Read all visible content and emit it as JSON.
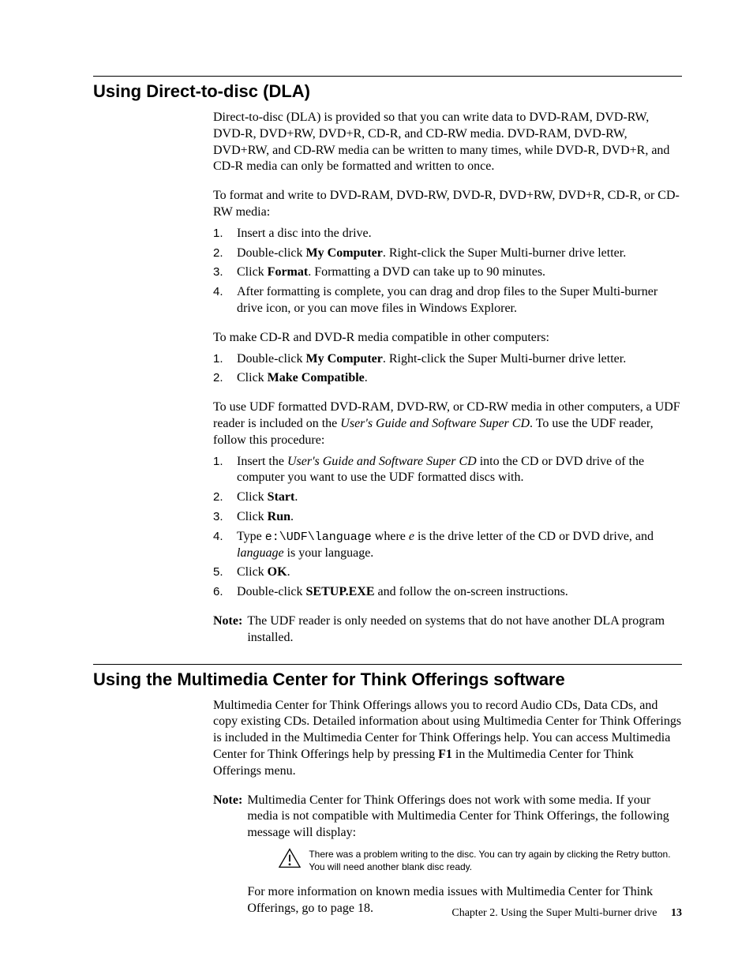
{
  "section1": {
    "heading": "Using Direct-to-disc (DLA)",
    "intro": "Direct-to-disc (DLA) is provided so that you can write data to DVD-RAM, DVD-RW, DVD-R, DVD+RW, DVD+R, CD-R, and CD-RW media. DVD-RAM, DVD-RW, DVD+RW, and CD-RW media can be written to many times, while DVD-R, DVD+R, and CD-R media can only be formatted and written to once.",
    "lead1": "To format and write to DVD-RAM, DVD-RW, DVD-R, DVD+RW, DVD+R, CD-R, or CD-RW media:",
    "steps1": {
      "s1": "Insert a disc into the drive.",
      "s2a": "Double-click ",
      "s2b": "My Computer",
      "s2c": ". Right-click the Super Multi-burner drive letter.",
      "s3a": "Click ",
      "s3b": "Format",
      "s3c": ". Formatting a DVD can take up to 90 minutes.",
      "s4": "After formatting is complete, you can drag and drop files to the Super Multi-burner drive icon, or you can move files in Windows Explorer."
    },
    "lead2": "To make CD-R and DVD-R media compatible in other computers:",
    "steps2": {
      "s1a": "Double-click ",
      "s1b": "My Computer",
      "s1c": ". Right-click the Super Multi-burner drive letter.",
      "s2a": "Click ",
      "s2b": "Make Compatible",
      "s2c": "."
    },
    "lead3a": "To use UDF formatted DVD-RAM, DVD-RW, or CD-RW media in other computers, a UDF reader is included on the ",
    "lead3b": "User's Guide and Software Super CD",
    "lead3c": ". To use the UDF reader, follow this procedure:",
    "steps3": {
      "s1a": "Insert the ",
      "s1b": "User's Guide and Software Super CD",
      "s1c": " into the CD or DVD drive of the computer you want to use the UDF formatted discs with.",
      "s2a": "Click ",
      "s2b": "Start",
      "s2c": ".",
      "s3a": "Click ",
      "s3b": "Run",
      "s3c": ".",
      "s4a": "Type ",
      "s4b": "e:\\UDF\\language",
      "s4c": " where ",
      "s4d": "e",
      "s4e": " is the drive letter of the CD or DVD drive, and ",
      "s4f": "language",
      "s4g": " is your language.",
      "s5a": "Click ",
      "s5b": "OK",
      "s5c": ".",
      "s6a": "Double-click ",
      "s6b": "SETUP.EXE",
      "s6c": " and follow the on-screen instructions."
    },
    "note_label": "Note:",
    "note_body": "The UDF reader is only needed on systems that do not have another DLA program installed."
  },
  "section2": {
    "heading": "Using the Multimedia Center for Think Offerings software",
    "intro_a": "Multimedia Center for Think Offerings allows you to record Audio CDs, Data CDs, and copy existing CDs. Detailed information about using Multimedia Center for Think Offerings is included in the Multimedia Center for Think Offerings help. You can access Multimedia Center for Think Offerings help by pressing ",
    "intro_b": "F1",
    "intro_c": " in the Multimedia Center for Think Offerings menu.",
    "note_label": "Note:",
    "note_body": "Multimedia Center for Think Offerings does not work with some media. If your media is not compatible with Multimedia Center for Think Offerings, the following message will display:",
    "alert_text": "There was a problem writing to the disc. You can try again by clicking the Retry button. You will need another blank disc ready.",
    "after_alert": "For more information on known media issues with Multimedia Center for Think Offerings, go to page 18."
  },
  "footer": {
    "chapter": "Chapter 2. Using the Super Multi-burner drive",
    "page": "13"
  }
}
